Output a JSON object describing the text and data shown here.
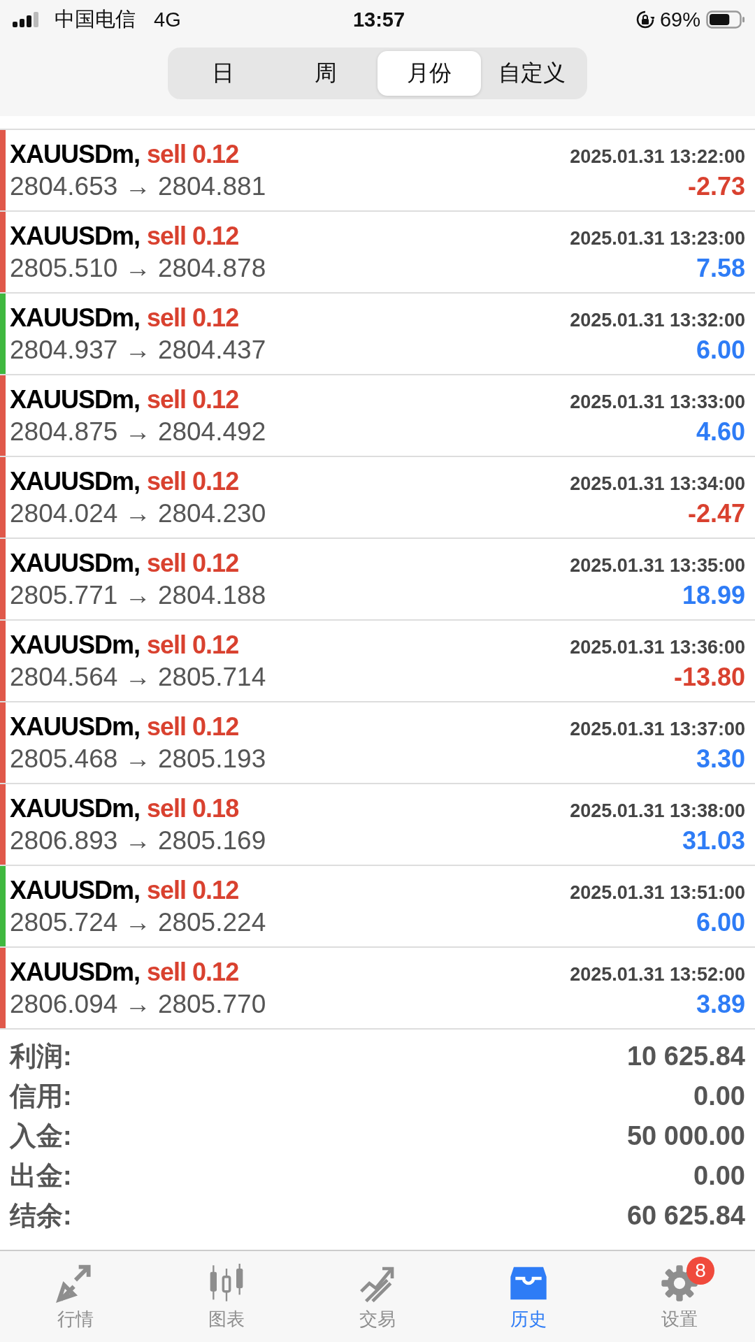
{
  "status_bar": {
    "carrier": "中国电信",
    "network": "4G",
    "time": "13:57",
    "battery": "69%"
  },
  "period_tabs": [
    {
      "label": "日",
      "selected": false
    },
    {
      "label": "周",
      "selected": false
    },
    {
      "label": "月份",
      "selected": true
    },
    {
      "label": "自定义",
      "selected": false
    }
  ],
  "deals": [
    {
      "symbol": "XAUUSDm,",
      "side": "sell 0.12",
      "time": "2025.01.31 13:22:00",
      "prices": "2804.653 → 2804.881",
      "profit": "-2.73",
      "loss": true,
      "color": "#e0584a"
    },
    {
      "symbol": "XAUUSDm,",
      "side": "sell 0.12",
      "time": "2025.01.31 13:23:00",
      "prices": "2805.510 → 2804.878",
      "profit": "7.58",
      "loss": false,
      "color": "#e0584a"
    },
    {
      "symbol": "XAUUSDm,",
      "side": "sell 0.12",
      "time": "2025.01.31 13:32:00",
      "prices": "2804.937 → 2804.437",
      "profit": "6.00",
      "loss": false,
      "color": "#3fb83f"
    },
    {
      "symbol": "XAUUSDm,",
      "side": "sell 0.12",
      "time": "2025.01.31 13:33:00",
      "prices": "2804.875 → 2804.492",
      "profit": "4.60",
      "loss": false,
      "color": "#e0584a"
    },
    {
      "symbol": "XAUUSDm,",
      "side": "sell 0.12",
      "time": "2025.01.31 13:34:00",
      "prices": "2804.024 → 2804.230",
      "profit": "-2.47",
      "loss": true,
      "color": "#e0584a"
    },
    {
      "symbol": "XAUUSDm,",
      "side": "sell 0.12",
      "time": "2025.01.31 13:35:00",
      "prices": "2805.771 → 2804.188",
      "profit": "18.99",
      "loss": false,
      "color": "#e0584a"
    },
    {
      "symbol": "XAUUSDm,",
      "side": "sell 0.12",
      "time": "2025.01.31 13:36:00",
      "prices": "2804.564 → 2805.714",
      "profit": "-13.80",
      "loss": true,
      "color": "#e0584a"
    },
    {
      "symbol": "XAUUSDm,",
      "side": "sell 0.12",
      "time": "2025.01.31 13:37:00",
      "prices": "2805.468 → 2805.193",
      "profit": "3.30",
      "loss": false,
      "color": "#e0584a"
    },
    {
      "symbol": "XAUUSDm,",
      "side": "sell 0.18",
      "time": "2025.01.31 13:38:00",
      "prices": "2806.893 → 2805.169",
      "profit": "31.03",
      "loss": false,
      "color": "#e0584a"
    },
    {
      "symbol": "XAUUSDm,",
      "side": "sell 0.12",
      "time": "2025.01.31 13:51:00",
      "prices": "2805.724 → 2805.224",
      "profit": "6.00",
      "loss": false,
      "color": "#3fb83f"
    },
    {
      "symbol": "XAUUSDm,",
      "side": "sell 0.12",
      "time": "2025.01.31 13:52:00",
      "prices": "2806.094 → 2805.770",
      "profit": "3.89",
      "loss": false,
      "color": "#e0584a"
    }
  ],
  "summary": [
    {
      "label": "利润:",
      "value": "10 625.84"
    },
    {
      "label": "信用:",
      "value": "0.00"
    },
    {
      "label": "入金:",
      "value": "50 000.00"
    },
    {
      "label": "出金:",
      "value": "0.00"
    },
    {
      "label": "结余:",
      "value": "60 625.84"
    }
  ],
  "tab_bar": [
    {
      "kind": "quotes",
      "label": "行情",
      "selected": false
    },
    {
      "kind": "chart",
      "label": "图表",
      "selected": false
    },
    {
      "kind": "trade",
      "label": "交易",
      "selected": false
    },
    {
      "kind": "history",
      "label": "历史",
      "selected": true
    },
    {
      "kind": "settings",
      "label": "设置",
      "selected": false,
      "badge": "8"
    }
  ]
}
